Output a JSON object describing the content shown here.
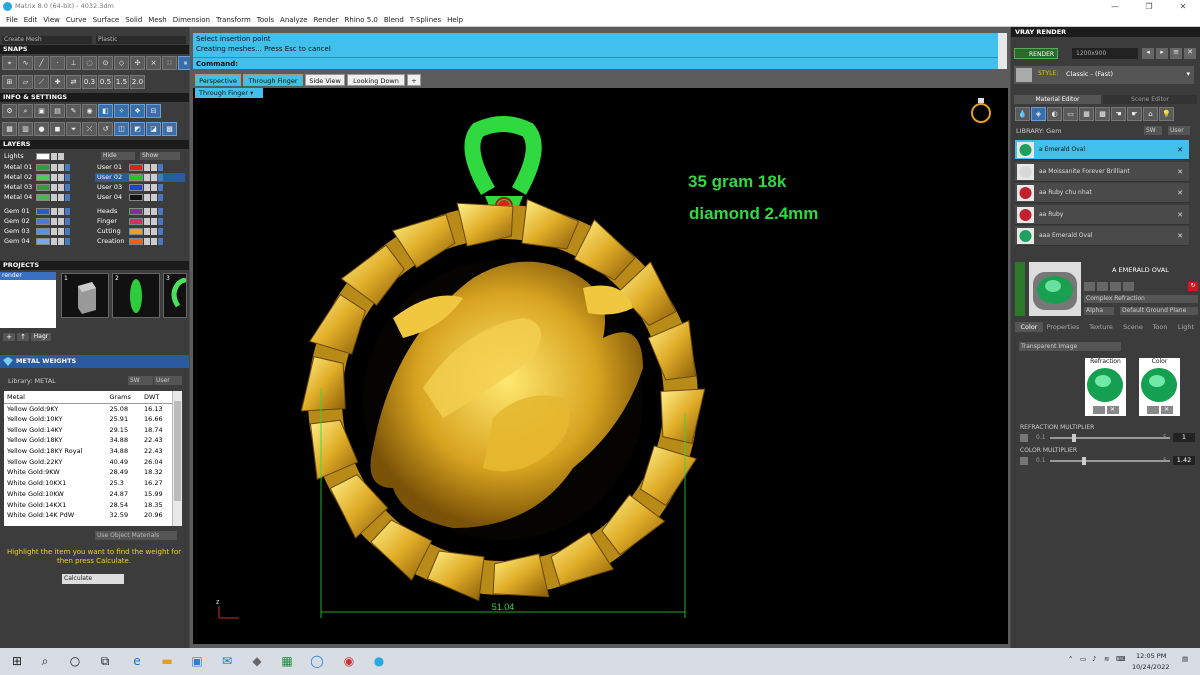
{
  "title": "Matrix 8.0 (64-bit) - 4032.3dm",
  "window_controls": [
    "—",
    "❐",
    "✕"
  ],
  "menu": [
    "File",
    "Edit",
    "View",
    "Curve",
    "Surface",
    "Solid",
    "Mesh",
    "Dimension",
    "Transform",
    "Tools",
    "Analyze",
    "Render",
    "Rhino 5.0",
    "Blend",
    "T-Splines",
    "Help"
  ],
  "top_left_fields": [
    "Create Mesh",
    "Plastic"
  ],
  "snaps_label": "SNAPS",
  "snaps_numbers": [
    "0.3",
    "0.5",
    "1.5",
    "2.0"
  ],
  "info_label": "INFO & SETTINGS",
  "layers": {
    "title": "LAYERS",
    "lights": "Lights",
    "hide": "Hide",
    "show": "Show",
    "left": [
      "Metal 01",
      "Metal 02",
      "Metal 03",
      "Metal 04",
      "Gem 01",
      "Gem 02",
      "Gem 03",
      "Gem 04"
    ],
    "right": [
      "User 01",
      "User 02",
      "User 03",
      "User 04",
      "Heads",
      "Finger",
      "Cutting",
      "Creation"
    ],
    "left_colors": [
      "#2e9e3e",
      "#4acf5a",
      "#2e9e3e",
      "#3fbf4f",
      "#2c58c8",
      "#4a78e0",
      "#5a90e8",
      "#7aa8f0"
    ],
    "right_colors": [
      "#e02020",
      "#2ebe2e",
      "#2040e0",
      "#111111",
      "#8a2aa0",
      "#d03060",
      "#f0a020",
      "#f06010"
    ]
  },
  "projects": {
    "title": "PROJECTS",
    "items": [
      "render"
    ],
    "thumbs": [
      "1",
      "2",
      "3"
    ],
    "buttons": [
      "+",
      "↑",
      "Hagr"
    ]
  },
  "metal_weights": {
    "title": "METAL WEIGHTS",
    "library": "Library: METAL",
    "sw": "SW",
    "user": "User",
    "headers": [
      "Metal",
      "Grams",
      "DWT"
    ],
    "rows": [
      [
        "Yellow Gold:9KY",
        "25.08",
        "16.13"
      ],
      [
        "Yellow Gold:10KY",
        "25.91",
        "16.66"
      ],
      [
        "Yellow Gold:14KY",
        "29.15",
        "18.74"
      ],
      [
        "Yellow Gold:18KY",
        "34.88",
        "22.43"
      ],
      [
        "Yellow Gold:18KY Royal",
        "34.88",
        "22.43"
      ],
      [
        "Yellow Gold:22KY",
        "40.49",
        "26.04"
      ],
      [
        "White Gold:9KW",
        "28.49",
        "18.32"
      ],
      [
        "White Gold:10KX1",
        "25.3",
        "16.27"
      ],
      [
        "White Gold:10KW",
        "24.87",
        "15.99"
      ],
      [
        "White Gold:14KX1",
        "28.54",
        "18.35"
      ],
      [
        "White Gold:14K PdW",
        "32.59",
        "20.96"
      ]
    ],
    "use_object": "Use Object Materials",
    "hint": "Highlight the item you want to find the weight for then press Calculate.",
    "calculate": "Calculate"
  },
  "command": {
    "line1": "Select insertion point",
    "line2": "Creating meshes... Press Esc to cancel",
    "label": "Command:"
  },
  "view_tabs": [
    "Perspective",
    "Through Finger",
    "Side View",
    "Looking Down",
    "+"
  ],
  "viewport_name": "Through Finger",
  "annotations": {
    "weight": "35 gram 18k",
    "diamond": "diamond 2.4mm",
    "dimension": "51.04"
  },
  "axis_label": "z",
  "vray": {
    "title": "VRAY RENDER",
    "render": "RENDER",
    "resolution": "1200x900",
    "style_label": "STYLE:",
    "style": "Classic - (Fast)",
    "tabs": [
      "Material Editor",
      "Scene Editor"
    ],
    "library": "LIBRARY: Gem",
    "sw": "SW",
    "user": "User",
    "items": [
      "a Emerald Oval",
      "aa Moissanite Forever Brilliant",
      "aa Ruby chu nhat",
      "aa Ruby",
      "aaa Emerald Oval"
    ],
    "item_colors": [
      "#20a060",
      "#d8d8d8",
      "#c02030",
      "#c02030",
      "#20a060"
    ],
    "preview_title": "A EMERALD OVAL",
    "complex": "Complex Refraction",
    "alpha": "Alpha",
    "ground": "Default Ground Plane",
    "subtabs": [
      "Color",
      "Properties",
      "Texture",
      "Scene",
      "Toon",
      "Light"
    ],
    "transparent": "Transparent Image",
    "refraction": "Refraction",
    "color": "Color",
    "refr_mult": "REFRACTION MULTIPLIER",
    "refr_min": "0.1",
    "refr_max": "5",
    "refr_val": "1",
    "refr_level": 0.18,
    "col_mult": "COLOR MULTIPLIER",
    "col_min": "0.1",
    "col_max": "5",
    "col_val": "1.42",
    "col_level": 0.27
  },
  "taskbar": {
    "time": "12:05 PM",
    "date": "10/24/2022"
  }
}
